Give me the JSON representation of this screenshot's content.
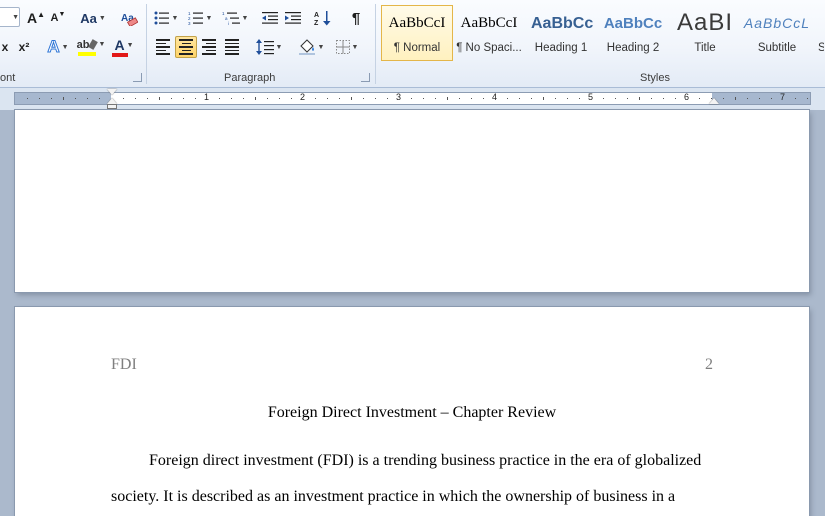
{
  "ribbon": {
    "font_group": {
      "label": "ont",
      "grow_font_icon": "A",
      "shrink_font_icon": "A",
      "change_case_label": "Aa",
      "subscript_label": "x",
      "superscript_label": "x²",
      "text_effects_label": "A",
      "highlight_label": "ab",
      "font_color_label": "A",
      "highlight_color": "#ffff00",
      "font_color": "#e21818"
    },
    "paragraph_group": {
      "label": "Paragraph",
      "sort_label": "A↓Z",
      "show_marks_label": "¶"
    },
    "styles_group": {
      "label": "Styles",
      "tiles": [
        {
          "sample": "AaBbCcI",
          "name": "¶ Normal"
        },
        {
          "sample": "AaBbCcI",
          "name": "¶ No Spaci..."
        },
        {
          "sample": "AaBbCc",
          "name": "Heading 1"
        },
        {
          "sample": "AaBbCc",
          "name": "Heading 2"
        },
        {
          "sample": "AaBI",
          "name": "Title"
        },
        {
          "sample": "AaBbCcL",
          "name": "Subtitle"
        },
        {
          "sample": "",
          "name": "S"
        }
      ]
    }
  },
  "ruler": {
    "numbers": [
      "1",
      "2",
      "3",
      "4",
      "5",
      "6",
      "7"
    ]
  },
  "document": {
    "page2": {
      "header_left": "FDI",
      "header_right": "2",
      "title": "Foreign Direct Investment – Chapter Review",
      "line1": "Foreign direct investment (FDI) is a trending business practice in the era of globalized",
      "line2": "society. It is described as an investment practice in which the ownership of business in a"
    }
  }
}
